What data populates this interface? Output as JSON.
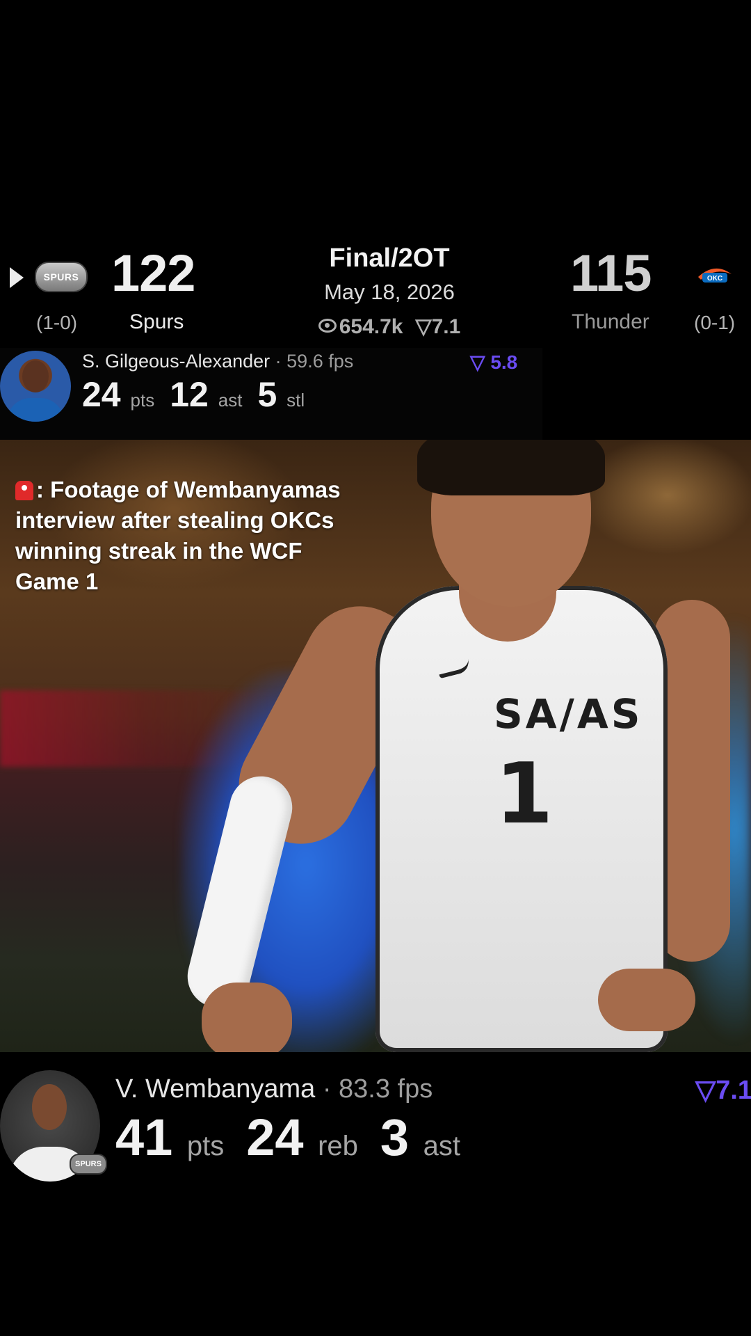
{
  "game": {
    "home": {
      "score": "122",
      "name": "Spurs",
      "record": "(1-0)",
      "logo_text": "SPURS"
    },
    "away": {
      "score": "115",
      "name": "Thunder",
      "record": "(0-1)",
      "logo_text": "OKC"
    },
    "status": "Final/2OT",
    "date": "May 18, 2026",
    "views": "654.7k",
    "rating": "7.1"
  },
  "top_player": {
    "name": "S. Gilgeous-Alexander",
    "fps": "· 59.6 fps",
    "rating": "5.8",
    "stats": [
      {
        "value": "24",
        "unit": "pts"
      },
      {
        "value": "12",
        "unit": "ast"
      },
      {
        "value": "5",
        "unit": "stl"
      }
    ]
  },
  "caption": {
    "text": ": Footage of Wembanyamas interview after stealing OKCs winning streak in the WCF Game 1"
  },
  "video": {
    "jersey_text": "SA/AS",
    "jersey_number": "1"
  },
  "bottom_player": {
    "name": "V. Wembanyama",
    "fps": "· 83.3 fps",
    "rating": "7.1",
    "logo_text": "SPURS",
    "stats": [
      {
        "value": "41",
        "unit": "pts"
      },
      {
        "value": "24",
        "unit": "reb"
      },
      {
        "value": "3",
        "unit": "ast"
      }
    ]
  },
  "colors": {
    "accent": "#6a4cf2",
    "background": "#000000"
  },
  "icons": [
    "play-icon",
    "eye-icon",
    "rating-icon",
    "siren-icon"
  ]
}
